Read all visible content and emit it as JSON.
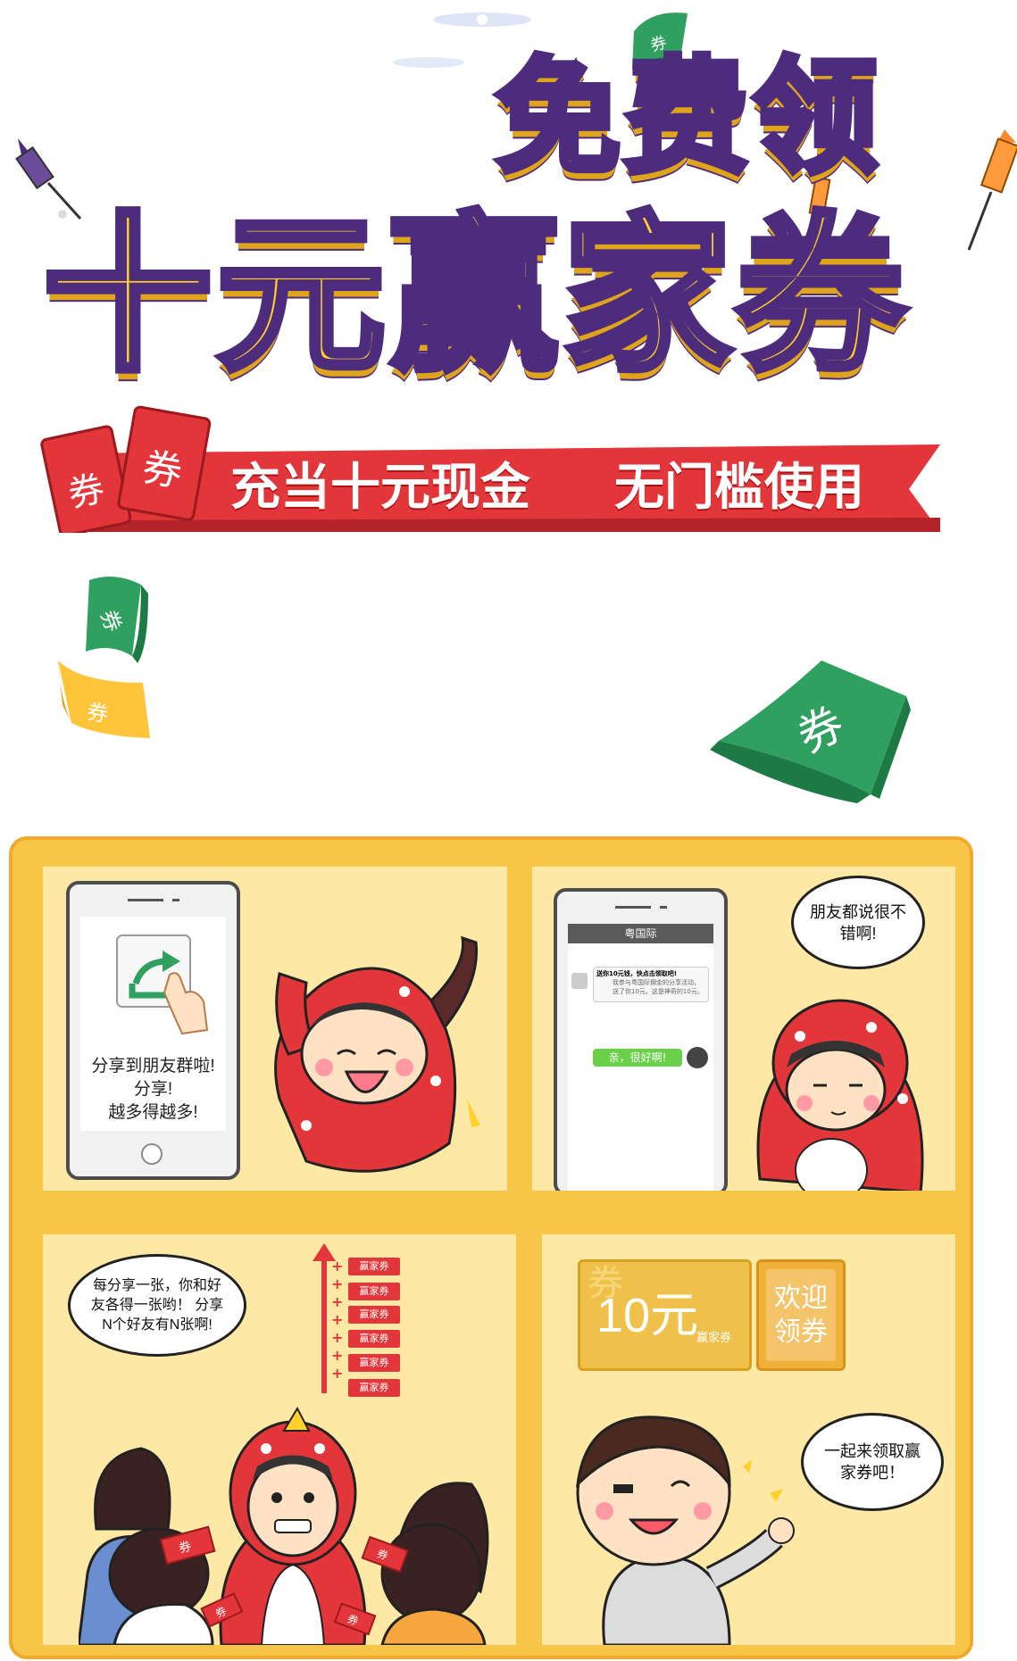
{
  "header": {
    "title_line1": "免费领",
    "title_line2": "十元赢家券",
    "ticket_char": "券",
    "banner_left": "充当十元现金",
    "banner_right": "无门槛使用",
    "floating_bill_char": "券"
  },
  "comic": {
    "panel1": {
      "caption_lines": [
        "分享到朋友群啦!",
        "分享!",
        "越多得越多!"
      ]
    },
    "panel2": {
      "speech": "朋友都说很不错啊!",
      "chat_title": "粤国际",
      "incoming_title": "送你10元钱，快点击领取吧!",
      "incoming_body": "我参与粤国际佣金的分享活动，送了你10元。这是神奇的10元。",
      "outgoing": "亲，很好啊!"
    },
    "panel3": {
      "speech": "每分享一张，你和好友各得一张哟！ 分享N个好友有N张啊!",
      "coupon_labels": [
        "赢家券",
        "赢家券",
        "赢家券",
        "赢家券",
        "赢家券",
        "赢家券"
      ],
      "held_coupon_char": "券"
    },
    "panel4": {
      "coupon_amount": "10元",
      "coupon_brand": "赢家券",
      "coupon_watermark": "券",
      "coupon_action_line1": "欢迎",
      "coupon_action_line2": "领券",
      "speech": "一起来领取赢家券吧！"
    }
  },
  "colors": {
    "title_yellow": "#ffd12a",
    "title_outline": "#4d2c7d",
    "banner_red": "#e3363a",
    "comic_bg": "#f7c548",
    "panel_bg": "#fde8a6",
    "bill_green": "#2fa060"
  },
  "icons": [
    "rocket-icon",
    "coupon-bill-icon",
    "share-icon",
    "hand-pointer-icon",
    "sparkle-icon"
  ]
}
